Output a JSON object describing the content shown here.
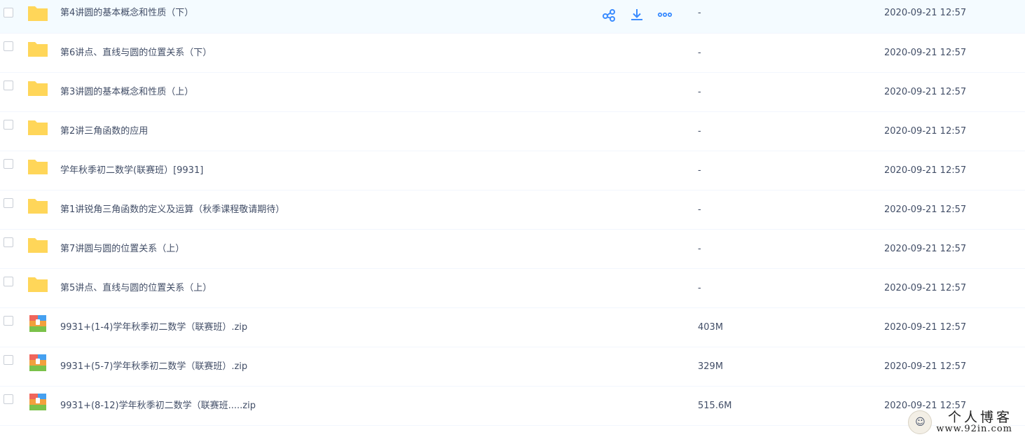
{
  "file_list": {
    "rows": [
      {
        "type": "folder",
        "name": "第4讲圆的基本概念和性质（下）",
        "size": "-",
        "mtime": "2020-09-21 12:57",
        "hovered": true
      },
      {
        "type": "folder",
        "name": "第6讲点、直线与圆的位置关系（下）",
        "size": "-",
        "mtime": "2020-09-21 12:57"
      },
      {
        "type": "folder",
        "name": "第3讲圆的基本概念和性质（上）",
        "size": "-",
        "mtime": "2020-09-21 12:57"
      },
      {
        "type": "folder",
        "name": "第2讲三角函数的应用",
        "size": "-",
        "mtime": "2020-09-21 12:57"
      },
      {
        "type": "folder",
        "name": "学年秋季初二数学(联赛班）[9931]",
        "size": "-",
        "mtime": "2020-09-21 12:57"
      },
      {
        "type": "folder",
        "name": "第1讲锐角三角函数的定义及运算（秋季课程敬请期待）",
        "size": "-",
        "mtime": "2020-09-21 12:57"
      },
      {
        "type": "folder",
        "name": "第7讲圆与圆的位置关系（上）",
        "size": "-",
        "mtime": "2020-09-21 12:57"
      },
      {
        "type": "folder",
        "name": "第5讲点、直线与圆的位置关系（上）",
        "size": "-",
        "mtime": "2020-09-21 12:57"
      },
      {
        "type": "zip",
        "name": "9931+(1-4)学年秋季初二数学（联赛班）.zip",
        "size": "403M",
        "mtime": "2020-09-21 12:57"
      },
      {
        "type": "zip",
        "name": "9931+(5-7)学年秋季初二数学（联赛班）.zip",
        "size": "329M",
        "mtime": "2020-09-21 12:57"
      },
      {
        "type": "zip",
        "name": "9931+(8-12)学年秋季初二数学（联赛班.....zip",
        "size": "515.6M",
        "mtime": "2020-09-21 12:57"
      }
    ],
    "hover_actions": [
      "share-icon",
      "download-icon",
      "more-icon"
    ]
  },
  "colors": {
    "accent": "#3b8cff",
    "folder": "#ffd659",
    "hover_bg": "#f4fbff"
  },
  "watermark": {
    "title": "个人博客",
    "url": "www.92in.com"
  }
}
